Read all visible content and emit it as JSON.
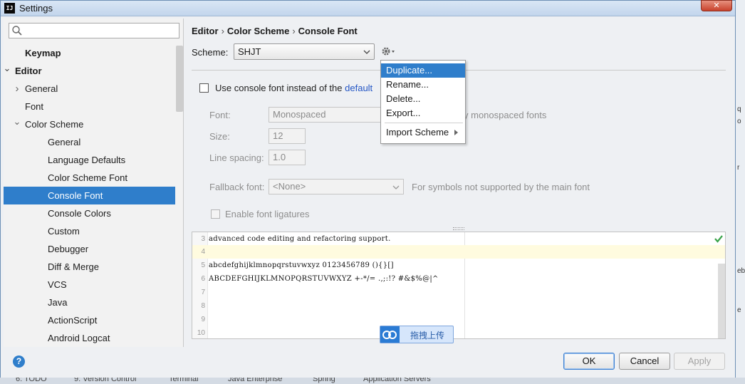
{
  "window": {
    "title": "Settings",
    "app_icon": "IJ"
  },
  "search": {
    "placeholder": "",
    "value": ""
  },
  "sidebar": {
    "items": [
      {
        "label": "Keymap",
        "level": 1,
        "bold": true
      },
      {
        "label": "Editor",
        "level": 0,
        "bold": true,
        "expanded": true
      },
      {
        "label": "General",
        "level": 1,
        "collapsed": true
      },
      {
        "label": "Font",
        "level": 1
      },
      {
        "label": "Color Scheme",
        "level": 1,
        "expanded": true
      },
      {
        "label": "General",
        "level": 2
      },
      {
        "label": "Language Defaults",
        "level": 2
      },
      {
        "label": "Color Scheme Font",
        "level": 2
      },
      {
        "label": "Console Font",
        "level": 2,
        "selected": true
      },
      {
        "label": "Console Colors",
        "level": 2
      },
      {
        "label": "Custom",
        "level": 2
      },
      {
        "label": "Debugger",
        "level": 2
      },
      {
        "label": "Diff & Merge",
        "level": 2
      },
      {
        "label": "VCS",
        "level": 2
      },
      {
        "label": "Java",
        "level": 2
      },
      {
        "label": "ActionScript",
        "level": 2
      },
      {
        "label": "Android Logcat",
        "level": 2
      }
    ]
  },
  "breadcrumb": [
    "Editor",
    "Color Scheme",
    "Console Font"
  ],
  "scheme": {
    "label": "Scheme:",
    "value": "SHJT"
  },
  "console_font": {
    "use_console_font_label_pre": "Use console font instead of the",
    "use_console_font_link": "default",
    "font_label": "Font:",
    "font_value": "Monospaced",
    "font_hint": "y monospaced fonts",
    "size_label": "Size:",
    "size_value": "12",
    "line_spacing_label": "Line spacing:",
    "line_spacing_value": "1.0",
    "fallback_label": "Fallback font:",
    "fallback_value": "<None>",
    "fallback_hint": "For symbols not supported by the main font",
    "ligatures_label": "Enable font ligatures"
  },
  "context_menu": {
    "items": [
      {
        "label": "Duplicate...",
        "selected": true
      },
      {
        "label": "Rename..."
      },
      {
        "label": "Delete..."
      },
      {
        "label": "Export..."
      },
      {
        "label": "Import Scheme",
        "submenu": true
      }
    ]
  },
  "editor": {
    "lines": [
      {
        "num": "3",
        "text": "advanced code editing and refactoring support."
      },
      {
        "num": "4",
        "text": "",
        "current": true
      },
      {
        "num": "5",
        "text": "abcdefghijklmnopqrstuvwxyz 0123456789 (){}[]"
      },
      {
        "num": "6",
        "text": "ABCDEFGHIJKLMNOPQRSTUVWXYZ +-*/= .,;:!? #&$%@|^"
      },
      {
        "num": "7",
        "text": ""
      },
      {
        "num": "8",
        "text": ""
      },
      {
        "num": "9",
        "text": ""
      },
      {
        "num": "10",
        "text": ""
      }
    ]
  },
  "upload_badge": {
    "label": "拖拽上传"
  },
  "buttons": {
    "help": "?",
    "ok": "OK",
    "cancel": "Cancel",
    "apply": "Apply"
  },
  "taskbar": [
    "6: TODO",
    "9: Version Control",
    "Terminal",
    "Java Enterprise",
    "Spring",
    "Application Servers"
  ],
  "colors": {
    "selection": "#2f7ecb",
    "link": "#2456c5",
    "current_line": "#fffbdf"
  }
}
